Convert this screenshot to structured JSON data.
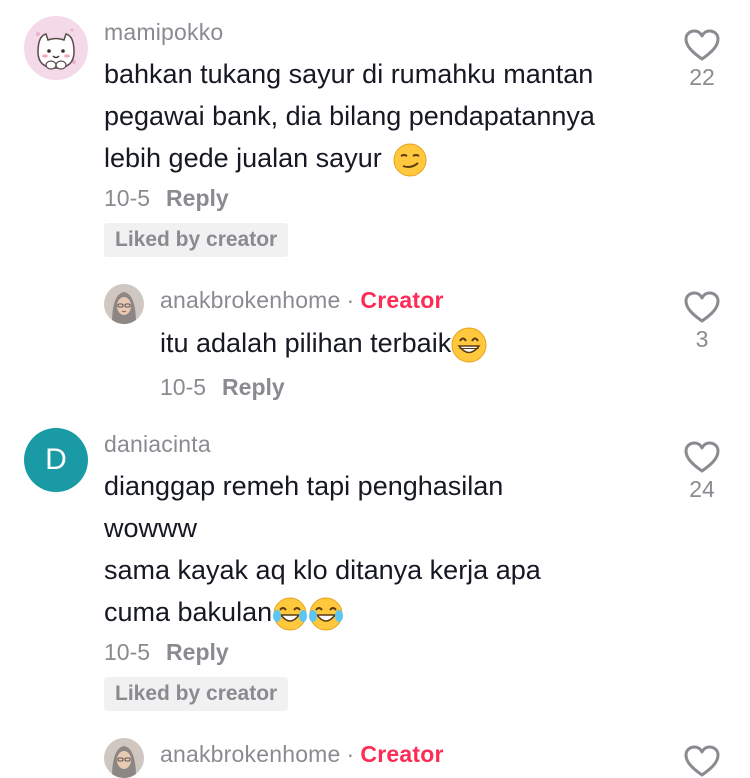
{
  "comments": [
    {
      "username": "mamipokko",
      "text_lines": [
        "bahkan tukang sayur di rumahku mantan",
        "pegawai bank, dia bilang pendapatannya",
        "lebih gede jualan sayur"
      ],
      "emoji": "smirk-emoji",
      "date": "10-5",
      "reply": "Reply",
      "badge": "Liked by creator",
      "likes": "22",
      "avatar": "cat-avatar"
    },
    {
      "username": "anakbrokenhome",
      "creator_label": "Creator",
      "text": "itu adalah pilihan terbaik",
      "emoji": "grin-emoji",
      "date": "10-5",
      "reply": "Reply",
      "likes": "3",
      "avatar": "woman-hijab-avatar"
    },
    {
      "username": "daniacinta",
      "avatar_letter": "D",
      "avatar_color": "#1a9aa5",
      "text_lines": [
        "dianggap remeh tapi penghasilan",
        "wowww",
        "sama kayak aq klo ditanya kerja apa",
        "cuma bakulan"
      ],
      "emoji": "tears-of-joy-emoji",
      "date": "10-5",
      "reply": "Reply",
      "badge": "Liked by creator",
      "likes": "24"
    },
    {
      "username": "anakbrokenhome",
      "creator_label": "Creator",
      "avatar": "woman-hijab-avatar"
    }
  ]
}
